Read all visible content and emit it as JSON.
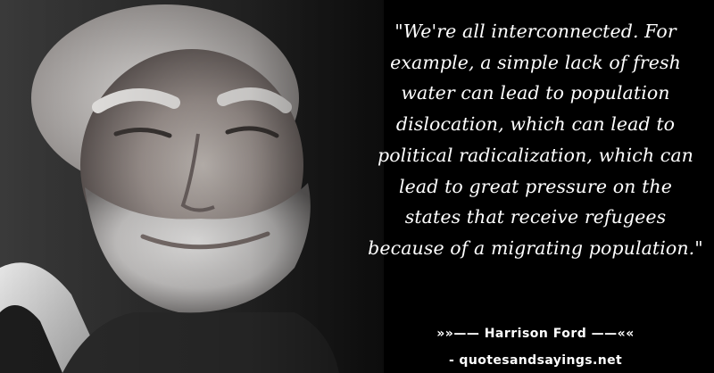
{
  "quote": {
    "text": "\"We're all interconnected. For\nexample, a simple lack of fresh\nwater can lead to population\ndislocation, which can lead to\npolitical radicalization, which can\nlead to great pressure on the\nstates that receive refugees\nbecause of a migrating population.\""
  },
  "attribution": {
    "author_line": "»»—— Harrison Ford ——««",
    "source_line": "- quotesandsayings.net"
  },
  "colors": {
    "background": "#000000",
    "text": "#ffffff"
  }
}
